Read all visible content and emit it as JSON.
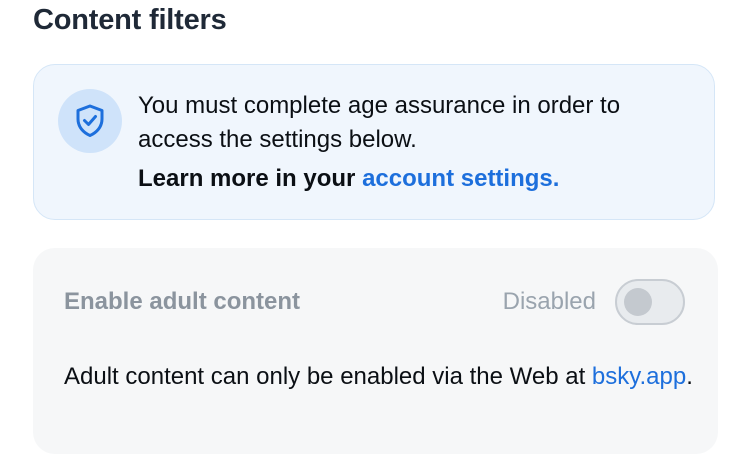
{
  "section": {
    "title": "Content filters"
  },
  "notice": {
    "message": "You must complete age assurance in order to access the settings below.",
    "learn_more_prefix": "Learn more in your ",
    "link_label": "account settings.",
    "icon": "shield-check-icon"
  },
  "adult_content": {
    "label": "Enable adult content",
    "status": "Disabled",
    "toggle_on": false,
    "description_prefix": "Adult content can only be enabled via the Web at ",
    "link_label": "bsky.app",
    "description_suffix": "."
  },
  "colors": {
    "accent": "#1d6fdc",
    "notice_bg": "#f0f6fd",
    "card_bg": "#f6f7f8"
  }
}
